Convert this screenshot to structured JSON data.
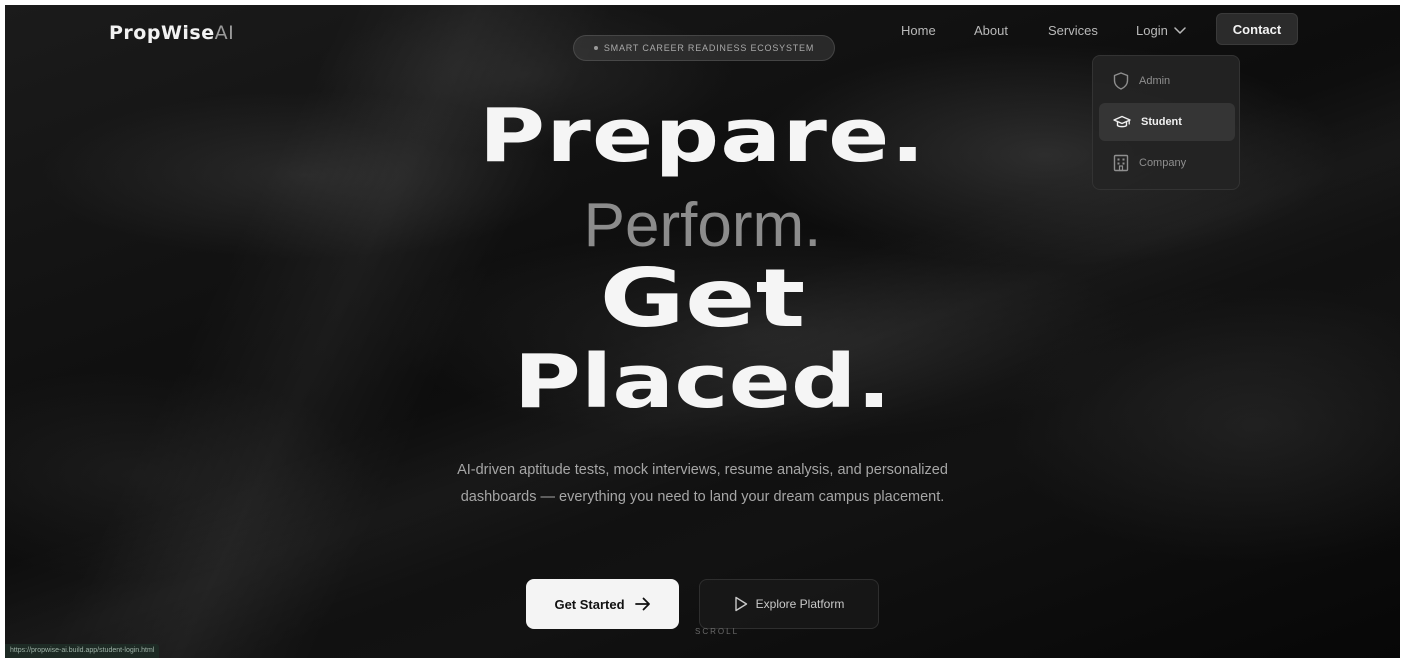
{
  "brand": {
    "name": "PropWise",
    "suffix": "AI"
  },
  "nav": {
    "links": [
      "Home",
      "About",
      "Services"
    ],
    "login_label": "Login",
    "contact_label": "Contact"
  },
  "login_menu": {
    "items": [
      {
        "label": "Admin",
        "icon": "shield-icon"
      },
      {
        "label": "Student",
        "icon": "graduation-cap-icon",
        "highlighted": true
      },
      {
        "label": "Company",
        "icon": "building-icon"
      }
    ]
  },
  "hero": {
    "eyebrow": "SMART CAREER READINESS ECOSYSTEM",
    "lines": [
      "Prepare.",
      "Perform.",
      "Get",
      "Placed."
    ],
    "subtitle": "AI-driven aptitude tests, mock interviews, resume analysis, and personalized dashboards — everything you need to land your dream campus placement.",
    "primary_cta": "Get Started",
    "secondary_cta": "Explore Platform",
    "scroll_hint": "SCROLL"
  },
  "status_bar": {
    "url": "https://propwise-ai.build.app/student-login.html"
  },
  "colors": {
    "background": "#0d0d0d",
    "headline": "#f5f5f5",
    "headline_muted": "#8c8c8c",
    "primary_button": "#f4f4f4"
  }
}
